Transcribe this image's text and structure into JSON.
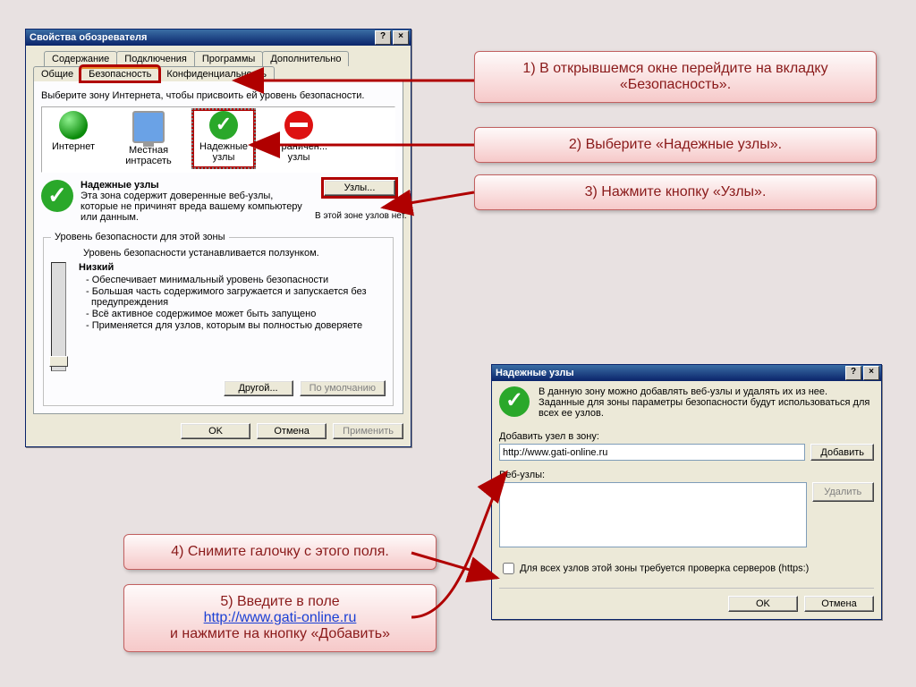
{
  "colors": {
    "accent_red": "#b00000"
  },
  "dialog1": {
    "title": "Свойства обозревателя",
    "tabs_row1": [
      "Содержание",
      "Подключения",
      "Программы",
      "Дополнительно"
    ],
    "tabs_row2": [
      "Общие",
      "Безопасность",
      "Конфиденциальность"
    ],
    "active_tab": "Безопасность",
    "zone_prompt": "Выберите зону Интернета, чтобы присвоить ей уровень безопасности.",
    "zones": [
      {
        "label": "Интернет",
        "icon": "globe-icon"
      },
      {
        "label": "Местная интрасеть",
        "icon": "monitor-icon"
      },
      {
        "label": "Надежные узлы",
        "icon": "check-icon",
        "selected": true
      },
      {
        "label": "Ограничен... узлы",
        "icon": "stop-icon"
      }
    ],
    "zone_name": "Надежные узлы",
    "zone_desc": "Эта зона содержит доверенные веб-узлы, которые не причинят вреда вашему компьютеру или данным.",
    "zone_status": "В этой зоне узлов нет.",
    "sites_btn": "Узлы...",
    "level_group": "Уровень безопасности для этой зоны",
    "level_hint": "Уровень безопасности устанавливается ползунком.",
    "level_name": "Низкий",
    "level_points": [
      "- Обеспечивает минимальный уровень безопасности",
      "- Большая часть содержимого загружается и запускается без предупреждения",
      "- Всё активное содержимое может быть запущено",
      "- Применяется для узлов, которым вы полностью доверяете"
    ],
    "custom_btn": "Другой...",
    "default_btn": "По умолчанию",
    "ok": "OK",
    "cancel": "Отмена",
    "apply": "Применить"
  },
  "dialog2": {
    "title": "Надежные узлы",
    "intro": "В данную зону можно добавлять веб-узлы и удалять их из нее. Заданные для зоны параметры безопасности будут использоваться для всех ее узлов.",
    "add_label": "Добавить узел в зону:",
    "add_value": "http://www.gati-online.ru",
    "add_btn": "Добавить",
    "list_label": "Веб-узлы:",
    "remove_btn": "Удалить",
    "https_cb": "Для всех узлов этой зоны требуется проверка серверов (https:)",
    "ok": "OK",
    "cancel": "Отмена"
  },
  "callouts": {
    "c1": "1) В открывшемся окне перейдите на вкладку «Безопасность».",
    "c2": "2) Выберите «Надежные узлы».",
    "c3": "3) Нажмите кнопку «Узлы».",
    "c4": "4) Снимите галочку с этого поля.",
    "c5_a": "5) Введите в поле",
    "c5_url": "http://www.gati-online.ru",
    "c5_b": "и нажмите на кнопку «Добавить»"
  }
}
